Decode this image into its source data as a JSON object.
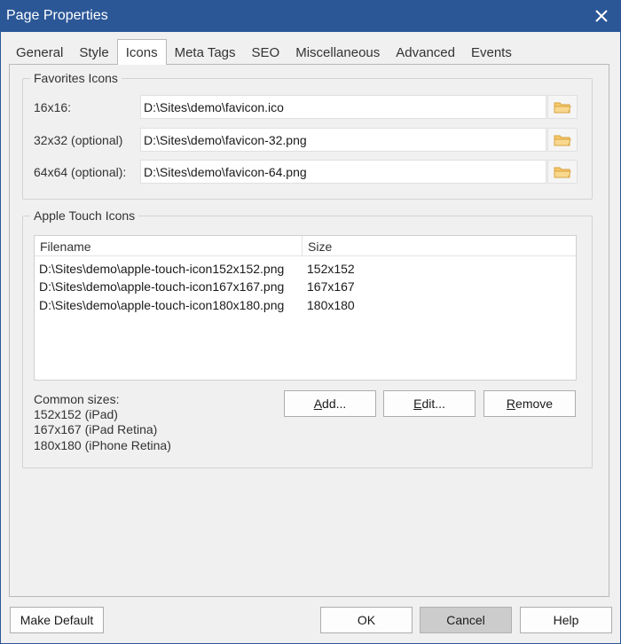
{
  "window": {
    "title": "Page Properties",
    "close_glyph": "✕"
  },
  "tabs": [
    {
      "label": "General",
      "active": false
    },
    {
      "label": "Style",
      "active": false
    },
    {
      "label": "Icons",
      "active": true
    },
    {
      "label": "Meta Tags",
      "active": false
    },
    {
      "label": "SEO",
      "active": false
    },
    {
      "label": "Miscellaneous",
      "active": false
    },
    {
      "label": "Advanced",
      "active": false
    },
    {
      "label": "Events",
      "active": false
    }
  ],
  "favorites": {
    "legend": "Favorites Icons",
    "rows": [
      {
        "label": "16x16:",
        "value": "D:\\Sites\\demo\\favicon.ico"
      },
      {
        "label": "32x32 (optional)",
        "value": "D:\\Sites\\demo\\favicon-32.png"
      },
      {
        "label": "64x64 (optional):",
        "value": "D:\\Sites\\demo\\favicon-64.png"
      }
    ]
  },
  "apple": {
    "legend": "Apple Touch Icons",
    "columns": [
      "Filename",
      "Size"
    ],
    "rows": [
      {
        "filename": "D:\\Sites\\demo\\apple-touch-icon152x152.png",
        "size": "152x152"
      },
      {
        "filename": "D:\\Sites\\demo\\apple-touch-icon167x167.png",
        "size": "167x167"
      },
      {
        "filename": "D:\\Sites\\demo\\apple-touch-icon180x180.png",
        "size": "180x180"
      }
    ],
    "common_sizes": [
      "Common sizes:",
      "152x152 (iPad)",
      "167x167 (iPad Retina)",
      "180x180 (iPhone Retina)"
    ],
    "buttons": {
      "add": "Add...",
      "edit": "Edit...",
      "remove": "Remove"
    }
  },
  "footer": {
    "make_default": "Make Default",
    "ok": "OK",
    "cancel": "Cancel",
    "help": "Help"
  },
  "colors": {
    "titlebar": "#2b5797",
    "folder": "#f5c76b",
    "window_bg": "#f0f0f0"
  }
}
